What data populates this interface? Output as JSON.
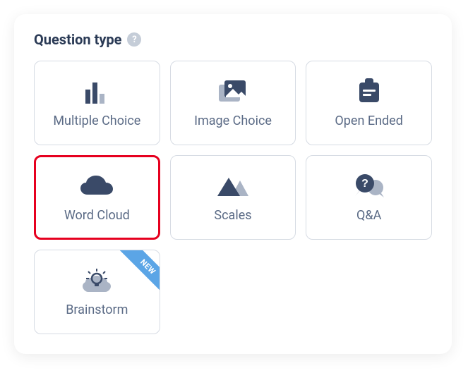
{
  "panel": {
    "title": "Question type"
  },
  "options": {
    "multiple_choice": {
      "label": "Multiple Choice"
    },
    "image_choice": {
      "label": "Image Choice"
    },
    "open_ended": {
      "label": "Open Ended"
    },
    "word_cloud": {
      "label": "Word Cloud",
      "selected": true
    },
    "scales": {
      "label": "Scales"
    },
    "qa": {
      "label": "Q&A"
    },
    "brainstorm": {
      "label": "Brainstorm",
      "badge": "NEW"
    }
  }
}
